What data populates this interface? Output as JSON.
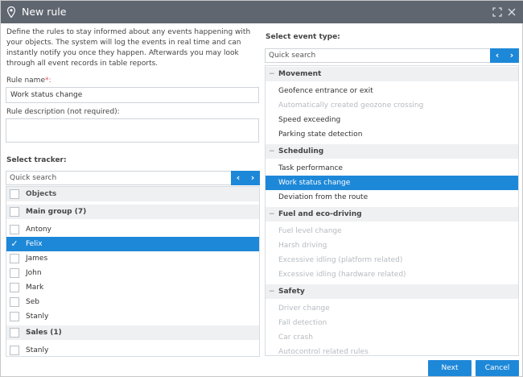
{
  "window": {
    "title": "New rule"
  },
  "intro": "Define the rules to stay informed about any events happening with your objects. The system will log the events in real time and can instantly notify you once they happen. Afterwards you may look through all event records in table reports.",
  "rule_name": {
    "label": "Rule name",
    "required_mark": "*:",
    "value": "Work status change"
  },
  "rule_description": {
    "label": "Rule description (not required):",
    "value": ""
  },
  "tracker": {
    "label": "Select tracker:",
    "search_placeholder": "Quick search",
    "header": "Objects",
    "rows": [
      {
        "kind": "group",
        "label": "Main group (7)",
        "checked": false
      },
      {
        "kind": "item",
        "label": "Antony",
        "checked": false
      },
      {
        "kind": "item",
        "label": "Felix",
        "checked": true
      },
      {
        "kind": "item",
        "label": "James",
        "checked": false
      },
      {
        "kind": "item",
        "label": "John",
        "checked": false
      },
      {
        "kind": "item",
        "label": "Mark",
        "checked": false
      },
      {
        "kind": "item",
        "label": "Seb",
        "checked": false
      },
      {
        "kind": "item",
        "label": "Stanly",
        "checked": false
      },
      {
        "kind": "group",
        "label": "Sales (1)",
        "checked": false
      },
      {
        "kind": "item",
        "label": "Stanly",
        "checked": false
      }
    ]
  },
  "event_type": {
    "label": "Select event type:",
    "search_placeholder": "Quick search",
    "rows": [
      {
        "kind": "category",
        "label": "Movement"
      },
      {
        "kind": "event",
        "label": "Geofence entrance or exit",
        "state": "enabled"
      },
      {
        "kind": "event",
        "label": "Automatically created geozone crossing",
        "state": "disabled"
      },
      {
        "kind": "event",
        "label": "Speed exceeding",
        "state": "enabled"
      },
      {
        "kind": "event",
        "label": "Parking state detection",
        "state": "enabled"
      },
      {
        "kind": "category",
        "label": "Scheduling"
      },
      {
        "kind": "event",
        "label": "Task performance",
        "state": "enabled"
      },
      {
        "kind": "event",
        "label": "Work status change",
        "state": "selected"
      },
      {
        "kind": "event",
        "label": "Deviation from the route",
        "state": "enabled"
      },
      {
        "kind": "category",
        "label": "Fuel and eco-driving"
      },
      {
        "kind": "event",
        "label": "Fuel level change",
        "state": "disabled"
      },
      {
        "kind": "event",
        "label": "Harsh driving",
        "state": "disabled"
      },
      {
        "kind": "event",
        "label": "Excessive idling (platform related)",
        "state": "disabled"
      },
      {
        "kind": "event",
        "label": "Excessive idling (hardware related)",
        "state": "disabled"
      },
      {
        "kind": "category",
        "label": "Safety"
      },
      {
        "kind": "event",
        "label": "Driver change",
        "state": "disabled"
      },
      {
        "kind": "event",
        "label": "Fall detection",
        "state": "disabled"
      },
      {
        "kind": "event",
        "label": "Car crash",
        "state": "disabled"
      },
      {
        "kind": "event",
        "label": "Autocontrol related rules",
        "state": "disabled"
      }
    ]
  },
  "buttons": {
    "next": "Next",
    "cancel": "Cancel"
  },
  "icons": {
    "pin": "map-pin-icon",
    "expand": "expand-icon",
    "close": "close-icon",
    "prev": "chevron-left-icon",
    "next": "chevron-right-icon",
    "check": "checkmark-icon",
    "collapse": "minus-icon"
  },
  "colors": {
    "accent": "#1e88d8",
    "titlebar": "#5f6670",
    "group_bg": "#eef0f2",
    "disabled_text": "#b6bbc0",
    "required": "#d9534f"
  }
}
